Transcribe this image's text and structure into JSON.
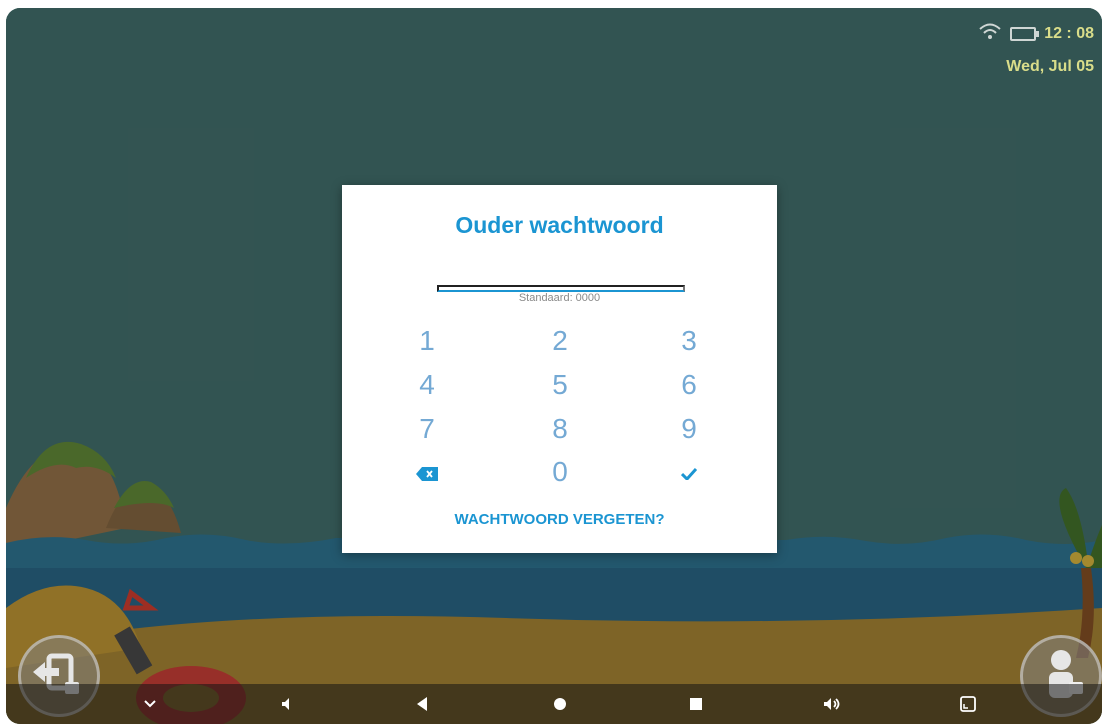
{
  "status_bar": {
    "time": "12 : 08",
    "date": "Wed, Jul 05",
    "wifi_icon": "wifi-icon",
    "battery_icon": "battery-icon"
  },
  "dialog": {
    "title": "Ouder wachtwoord",
    "password_value": "",
    "hint": "Standaard: 0000",
    "keys": [
      "1",
      "2",
      "3",
      "4",
      "5",
      "6",
      "7",
      "8",
      "9",
      "0"
    ],
    "backspace_icon": "backspace-icon",
    "confirm_icon": "checkmark-icon",
    "forgot_label": "WACHTWOORD VERGETEN?"
  },
  "navigation_bar": {
    "items": [
      "chevron-down-icon",
      "volume-down-icon",
      "back-icon",
      "home-icon",
      "recents-icon",
      "volume-up-icon",
      "screenshot-icon"
    ]
  },
  "colors": {
    "accent": "#1b95d2",
    "keypad": "#74a9d4",
    "status_text": "#d9dd8a",
    "background_sea": "#2c6e86"
  }
}
